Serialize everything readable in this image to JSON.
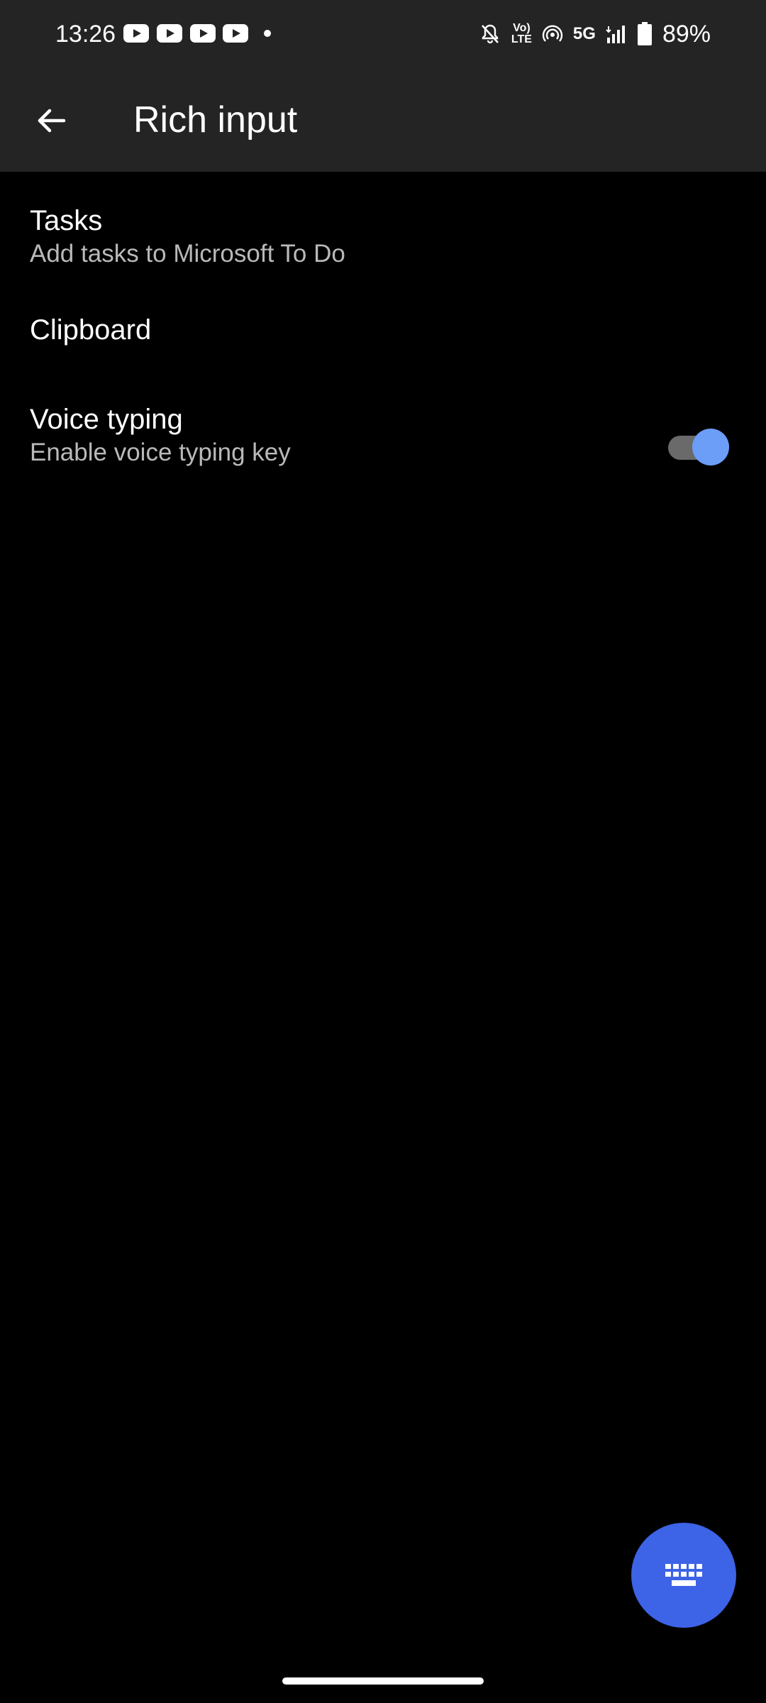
{
  "status_bar": {
    "time": "13:26",
    "notification_icons": [
      "youtube-icon",
      "youtube-icon",
      "youtube-icon",
      "youtube-icon",
      "dot-icon"
    ],
    "volte_label_top": "Vo)",
    "volte_label_bottom": "LTE",
    "network": "5G",
    "battery": "89%"
  },
  "app_bar": {
    "title": "Rich input",
    "back_icon": "arrow-left-icon"
  },
  "settings": [
    {
      "title": "Tasks",
      "subtitle": "Add tasks to Microsoft To Do"
    },
    {
      "title": "Clipboard"
    },
    {
      "title": "Voice typing",
      "subtitle": "Enable voice typing key",
      "toggle_on": true
    }
  ],
  "fab": {
    "icon": "keyboard-icon"
  },
  "colors": {
    "bar_background": "#242424",
    "background": "#000000",
    "toggle_thumb": "#6c9ef8",
    "fab": "#3d63e6",
    "subtitle_text": "#b9b9b9"
  }
}
